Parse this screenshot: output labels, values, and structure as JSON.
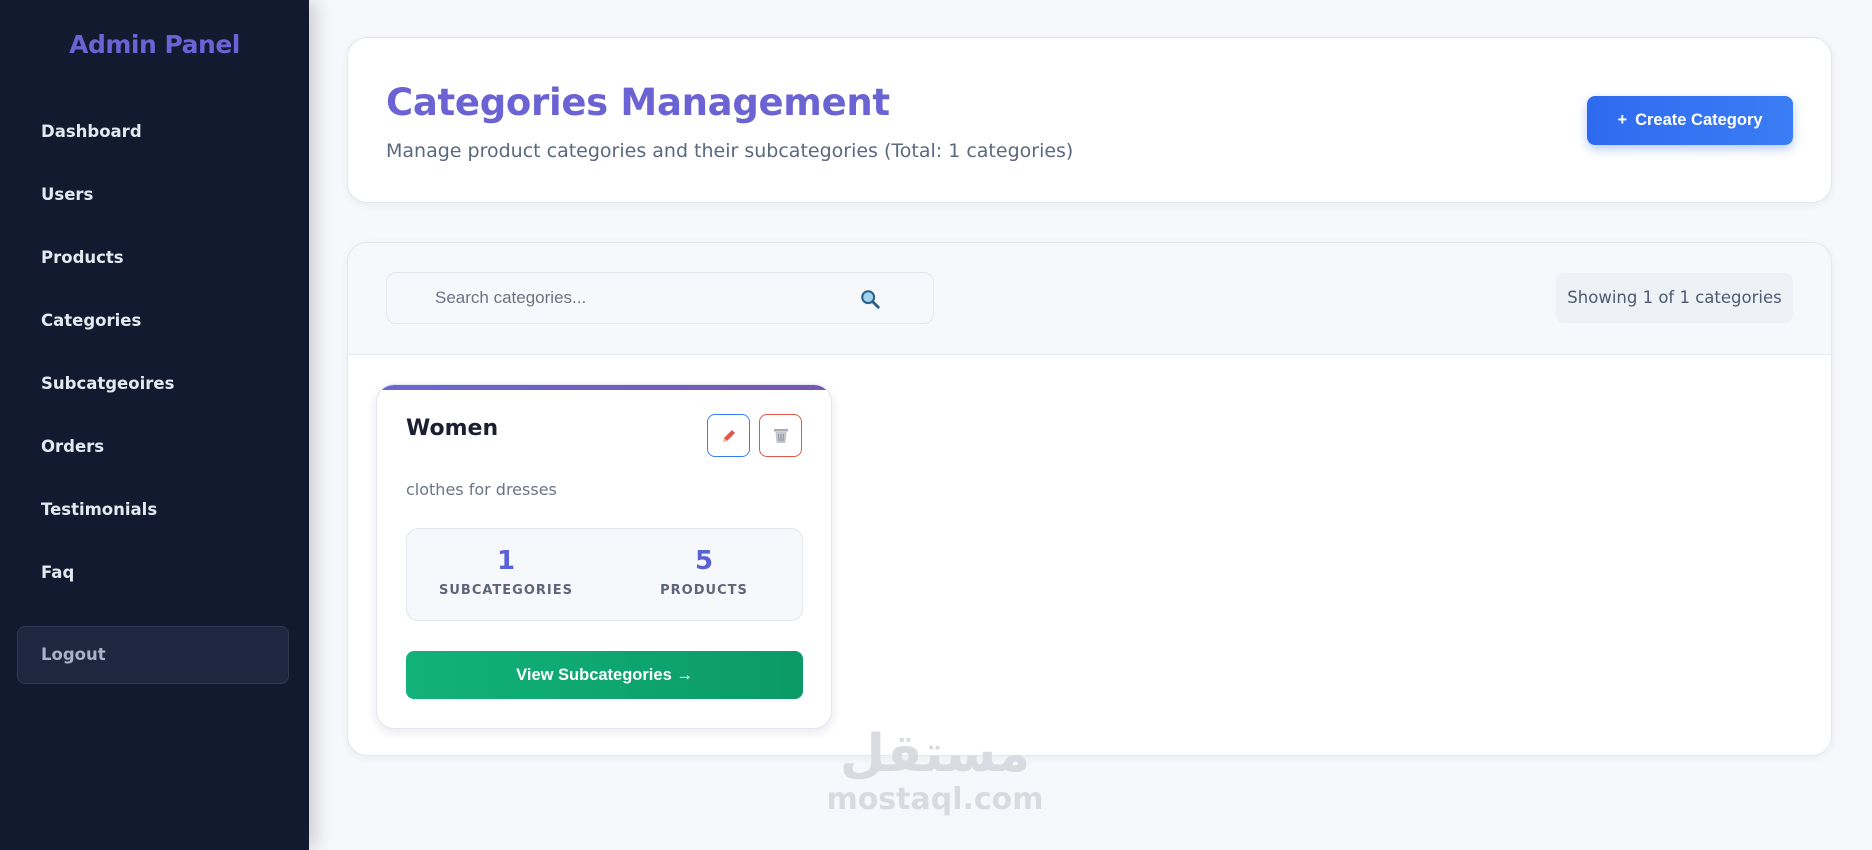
{
  "sidebar": {
    "brand": "Admin Panel",
    "items": [
      {
        "label": "Dashboard"
      },
      {
        "label": "Users"
      },
      {
        "label": "Products"
      },
      {
        "label": "Categories"
      },
      {
        "label": "Subcatgeoires"
      },
      {
        "label": "Orders"
      },
      {
        "label": "Testimonials"
      },
      {
        "label": "Faq"
      }
    ],
    "logout_label": "Logout"
  },
  "header": {
    "title": "Categories Management",
    "subtitle": "Manage product categories and their subcategories (Total: 1 categories)",
    "create_button_icon": "+",
    "create_button_label": "Create Category"
  },
  "toolbar": {
    "search_placeholder": "Search categories...",
    "search_icon": "search-icon",
    "showing_text": "Showing 1 of 1 categories"
  },
  "categories": [
    {
      "name": "Women",
      "description": "clothes for dresses",
      "subcategories_count": "1",
      "subcategories_label": "SUBCATEGORIES",
      "products_count": "5",
      "products_label": "PRODUCTS",
      "view_button_label": "View Subcategories →",
      "edit_icon": "pencil-icon",
      "delete_icon": "trash-icon"
    }
  ],
  "watermark": {
    "arabic": "مستقل",
    "latin": "mostaql.com"
  },
  "colors": {
    "sidebar_bg": "#111a2e",
    "brand": "#6b62d4",
    "primary": "#2e6af0",
    "success": "#12b27a",
    "danger": "#e0574a"
  }
}
